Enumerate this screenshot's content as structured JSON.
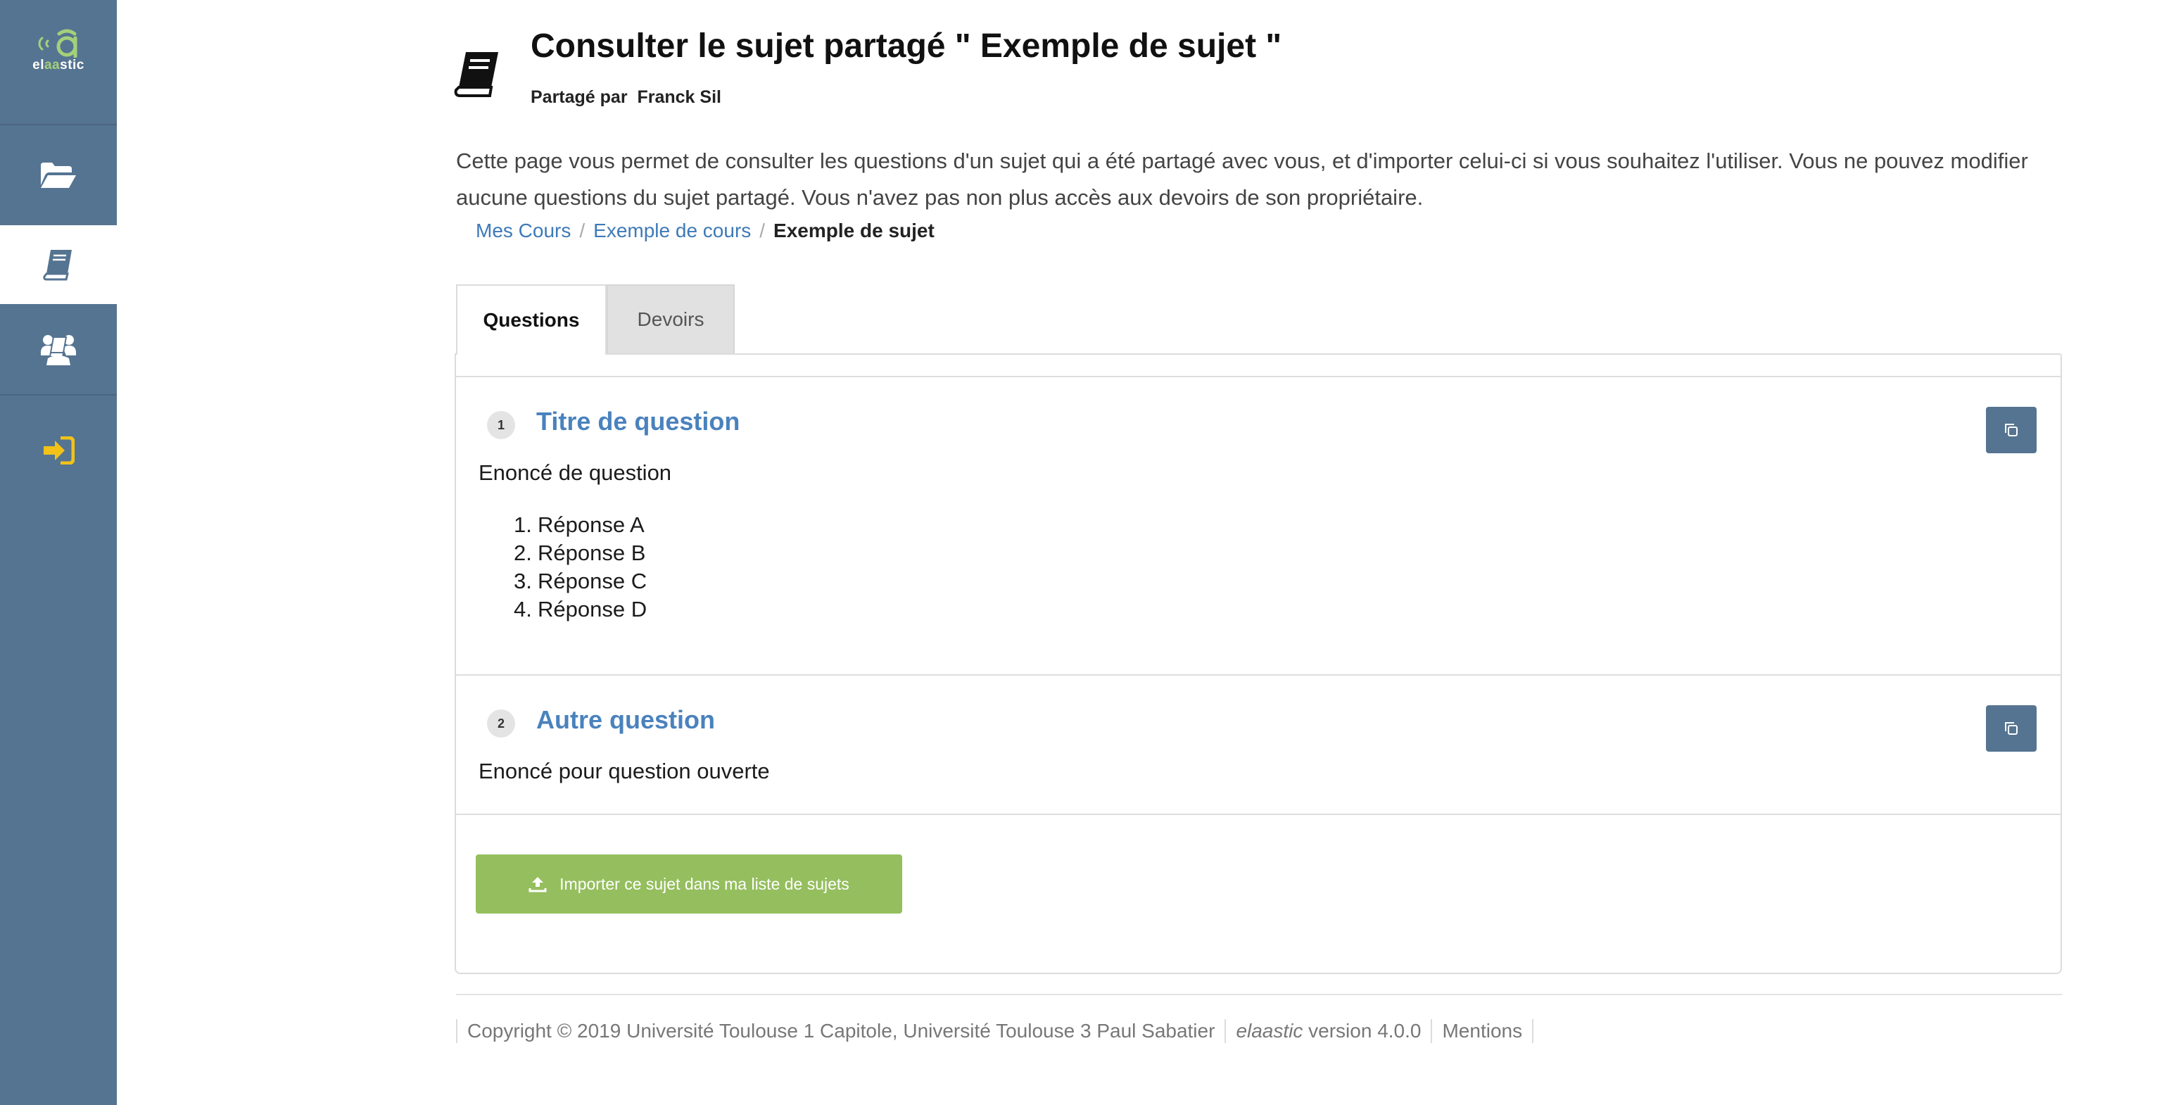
{
  "brand": {
    "logo_prefix": "el",
    "logo_highlight": "aa",
    "logo_suffix": "stic"
  },
  "sidebar": {
    "items": [
      {
        "name": "folder-open-icon",
        "active": false
      },
      {
        "name": "book-icon",
        "active": true
      },
      {
        "name": "users-icon",
        "active": false
      },
      {
        "name": "sign-in-icon",
        "active": false
      }
    ]
  },
  "header": {
    "title": "Consulter le sujet partagé \" Exemple de sujet \"",
    "shared_by_label": "Partagé par",
    "shared_by_name": "Franck Sil",
    "description": "Cette page vous permet de consulter les questions d'un sujet qui a été partagé avec vous, et d'importer celui-ci si vous souhaitez l'utiliser. Vous ne pouvez modifier aucune questions du sujet partagé. Vous n'avez pas non plus accès aux devoirs de son propriétaire."
  },
  "breadcrumb": {
    "items": [
      "Mes Cours",
      "Exemple de cours",
      "Exemple de sujet"
    ],
    "separator": "/"
  },
  "tabs": [
    {
      "label": "Questions",
      "active": true
    },
    {
      "label": "Devoirs",
      "active": false
    }
  ],
  "questions": [
    {
      "number": "1",
      "title": "Titre de question",
      "statement": "Enoncé de question",
      "answers": [
        {
          "n": "1.",
          "text": "Réponse A"
        },
        {
          "n": "2.",
          "text": "Réponse B"
        },
        {
          "n": "3.",
          "text": "Réponse C"
        },
        {
          "n": "4.",
          "text": "Réponse D"
        }
      ]
    },
    {
      "number": "2",
      "title": "Autre question",
      "statement": "Enoncé pour question ouverte"
    }
  ],
  "import_button": {
    "label": "Importer ce sujet dans ma liste de sujets"
  },
  "footer": {
    "copyright": "Copyright © 2019 Université Toulouse 1 Capitole, Université Toulouse 3 Paul Sabatier",
    "app_name": "elaastic",
    "version": "version 4.0.0",
    "mentions": "Mentions"
  },
  "colors": {
    "sidebar": "#557491",
    "link": "#3d7ab8",
    "question_title": "#4a82bd",
    "import_button": "#95be5e",
    "logo_accent": "#a5d07a",
    "sidebar_icon_signin": "#f2c218"
  }
}
